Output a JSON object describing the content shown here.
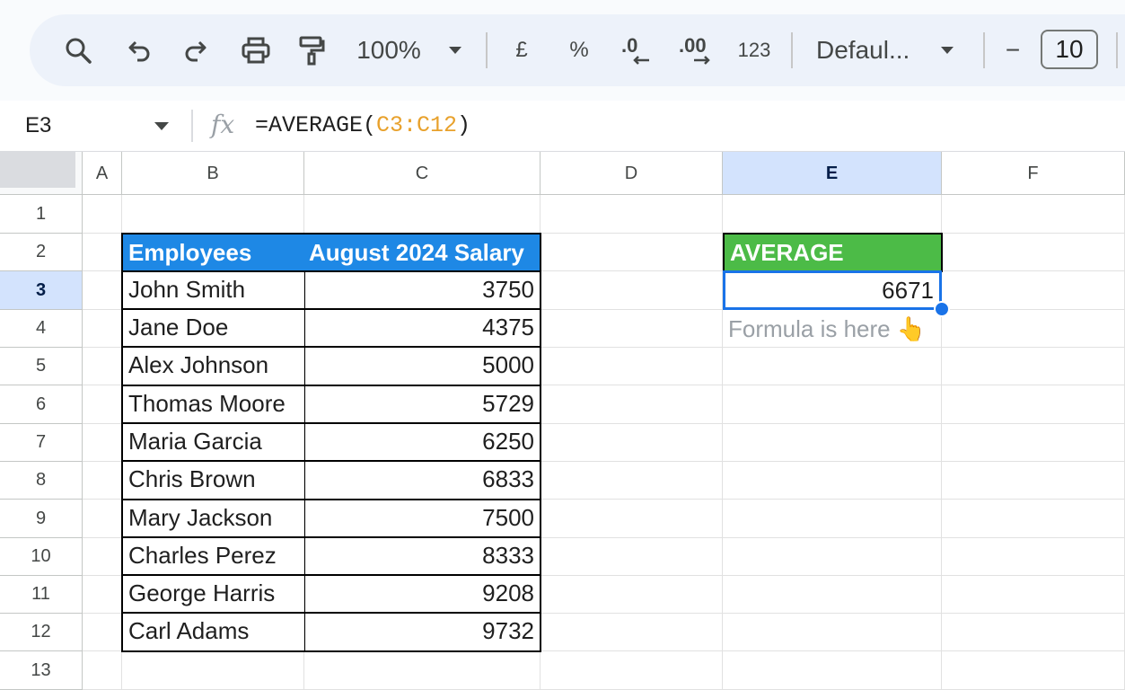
{
  "toolbar": {
    "zoom": "100%",
    "currency": "£",
    "percent": "%",
    "decrease_decimal": ".0",
    "increase_decimal": ".00",
    "more_formats": "123",
    "font_family": "Defaul...",
    "decrease_font": "−",
    "font_size": "10"
  },
  "formula_bar": {
    "name_box": "E3",
    "fx": "fx",
    "formula_prefix": "=AVERAGE(",
    "formula_ref": "C3:C12",
    "formula_suffix": ")"
  },
  "columns": [
    "A",
    "B",
    "C",
    "D",
    "E",
    "F"
  ],
  "rows": [
    "1",
    "2",
    "3",
    "4",
    "5",
    "6",
    "7",
    "8",
    "9",
    "10",
    "11",
    "12",
    "13"
  ],
  "table": {
    "header_employees": "Employees",
    "header_salary": "August 2024 Salary",
    "rows": [
      {
        "name": "John Smith",
        "salary": "3750"
      },
      {
        "name": "Jane Doe",
        "salary": "4375"
      },
      {
        "name": "Alex Johnson",
        "salary": "5000"
      },
      {
        "name": "Thomas Moore",
        "salary": "5729"
      },
      {
        "name": "Maria Garcia",
        "salary": "6250"
      },
      {
        "name": "Chris Brown",
        "salary": "6833"
      },
      {
        "name": "Mary Jackson",
        "salary": "7500"
      },
      {
        "name": "Charles Perez",
        "salary": "8333"
      },
      {
        "name": "George Harris",
        "salary": "9208"
      },
      {
        "name": "Carl Adams",
        "salary": "9732"
      }
    ]
  },
  "average": {
    "label": "AVERAGE",
    "value": "6671",
    "note": "Formula is here 👆"
  },
  "colors": {
    "header_blue": "#1e88e5",
    "average_green": "#4cbb47",
    "selection_blue": "#1a73e8",
    "reference_orange": "#e8a12c"
  }
}
